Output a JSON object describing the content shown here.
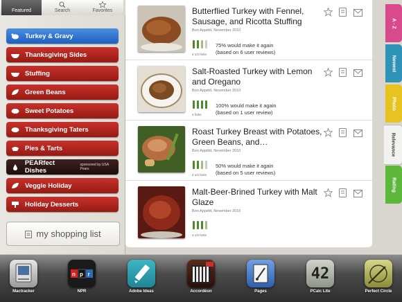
{
  "top_tabs": [
    {
      "label": "Featured",
      "active": true
    },
    {
      "label": "Search",
      "active": false
    },
    {
      "label": "Favorites",
      "active": false
    }
  ],
  "categories": [
    {
      "label": "Turkey & Gravy",
      "icon": "turkey-icon",
      "selected": true
    },
    {
      "label": "Thanksgiving Sides",
      "icon": "bowl-icon"
    },
    {
      "label": "Stuffing",
      "icon": "bowl-icon"
    },
    {
      "label": "Green Beans",
      "icon": "leaf-icon"
    },
    {
      "label": "Sweet Potatoes",
      "icon": "potato-icon"
    },
    {
      "label": "Thanksgiving Taters",
      "icon": "potato-icon"
    },
    {
      "label": "Pies & Tarts",
      "icon": "pie-icon"
    },
    {
      "label": "PEARfect Dishes",
      "sponsor": "sponsored by USA Pears",
      "icon": "pear-icon"
    },
    {
      "label": "Veggie Holiday",
      "icon": "leaf-icon"
    },
    {
      "label": "Holiday Desserts",
      "icon": "dessert-icon"
    }
  ],
  "shopping_list": {
    "label": "my shopping list"
  },
  "recipes": [
    {
      "title": "Butterflied Turkey with Fennel, Sausage, and Ricotta Stuffing",
      "source": "Bon Appétit, November 2010",
      "forks": "2 1/2 forks",
      "fork_rating": 2.5,
      "rating_line1": "75% would make it again",
      "rating_line2": "(based on 6 user reviews)"
    },
    {
      "title": "Salt-Roasted Turkey with Lemon and Oregano",
      "source": "Bon Appétit, November 2010",
      "forks": "4 forks",
      "fork_rating": 4,
      "rating_line1": "100% would make it again",
      "rating_line2": "(based on 1 user review)"
    },
    {
      "title": "Roast Turkey Breast with Potatoes, Green Beans, and…",
      "source": "Bon Appétit, November 2010",
      "forks": "2 1/2 forks",
      "fork_rating": 2.5,
      "rating_line1": "50% would make it again",
      "rating_line2": "(based on 5 user reviews)"
    },
    {
      "title": "Malt-Beer-Brined Turkey with Malt Glaze",
      "source": "Bon Appétit, November 2010",
      "forks": "3 1/2 forks",
      "fork_rating": 3.5,
      "rating_line1": "",
      "rating_line2": ""
    }
  ],
  "side_tabs": [
    {
      "label": "A - Z",
      "color": "#d94a8c"
    },
    {
      "label": "Newest",
      "color": "#2f93b8"
    },
    {
      "label": "Photo",
      "color": "#e8c21f"
    },
    {
      "label": "Relevance",
      "color": "#eeeeee",
      "active": true
    },
    {
      "label": "Rating",
      "color": "#5cb73a"
    }
  ],
  "dock_apps": [
    {
      "label": "Mactracker",
      "icon": "mactracker-icon"
    },
    {
      "label": "NPR",
      "icon": "npr-icon"
    },
    {
      "label": "Adobe Ideas",
      "icon": "adobe-ideas-icon"
    },
    {
      "label": "Accordéon",
      "icon": "accordion-icon"
    },
    {
      "label": "Pages",
      "icon": "pages-icon"
    },
    {
      "label": "PCalc Lite",
      "icon": "pcalc-icon",
      "display": "42"
    },
    {
      "label": "Perfect Circle",
      "icon": "perfect-circle-icon"
    }
  ]
}
